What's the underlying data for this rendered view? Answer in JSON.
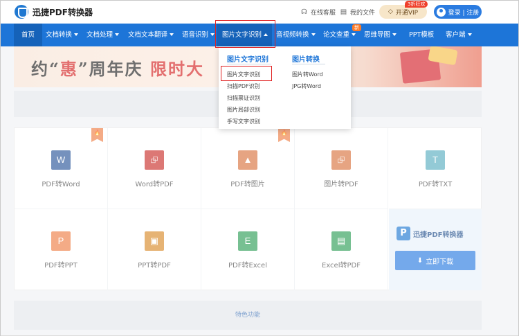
{
  "header": {
    "app_name": "迅捷PDF转换器",
    "support_label": "在线客服",
    "my_files_label": "我的文件",
    "vip_label": "开通VIP",
    "vip_badge": "3折狂欢",
    "login_label": "登录 | 注册"
  },
  "nav": {
    "items": [
      {
        "label": "首页"
      },
      {
        "label": "文档转换"
      },
      {
        "label": "文档处理"
      },
      {
        "label": "文档文本翻译"
      },
      {
        "label": "语音识别"
      },
      {
        "label": "图片文字识别"
      },
      {
        "label": "音视频转换"
      },
      {
        "label": "论文查重"
      },
      {
        "label": "思维导图"
      },
      {
        "label": "PPT模板"
      },
      {
        "label": "客户端"
      }
    ],
    "new_badge": "新"
  },
  "banner": {
    "text_part1": "约“",
    "text_red1": "惠",
    "text_part2": "”周年庆  ",
    "text_red2": "限时大"
  },
  "dropdown": {
    "col1_title": "图片文字识别",
    "col1_items": [
      "图片文字识别",
      "扫描PDF识别",
      "扫描票证识别",
      "图片局部识别",
      "手写文字识别"
    ],
    "col2_title": "图片转换",
    "col2_items": [
      "图片转Word",
      "JPG转Word"
    ]
  },
  "tools": {
    "row1": [
      {
        "label": "PDF转Word",
        "icon": "W",
        "icon_name": "word-icon",
        "color": "#2b579a"
      },
      {
        "label": "Word转PDF",
        "icon": "⮺",
        "icon_name": "pdf-icon",
        "color": "#c9302c"
      },
      {
        "label": "PDF转图片",
        "icon": "▲",
        "icon_name": "image-icon",
        "color": "#d9733f"
      },
      {
        "label": "图片转PDF",
        "icon": "⮺",
        "icon_name": "pdf-icon",
        "color": "#d9733f"
      },
      {
        "label": "PDF转TXT",
        "icon": "T",
        "icon_name": "txt-icon",
        "color": "#5aaec0"
      }
    ],
    "row2": [
      {
        "label": "PDF转PPT",
        "icon": "P",
        "icon_name": "ppt-icon",
        "color": "#ee7f45"
      },
      {
        "label": "PPT转PDF",
        "icon": "▣",
        "icon_name": "ppt-pdf-icon",
        "color": "#d98b2a"
      },
      {
        "label": "PDF转Excel",
        "icon": "E",
        "icon_name": "excel-icon",
        "color": "#2f9e58"
      },
      {
        "label": "Excel转PDF",
        "icon": "▤",
        "icon_name": "excel-pdf-icon",
        "color": "#2f9e58"
      }
    ],
    "hot_glyph": "🔥"
  },
  "promo": {
    "mark": "P",
    "name": "迅捷PDF转换器",
    "download_label": "立即下载"
  },
  "footer": {
    "feature_label": "特色功能"
  },
  "colors": {
    "primary": "#1d75d8",
    "highlight": "#e02020"
  }
}
